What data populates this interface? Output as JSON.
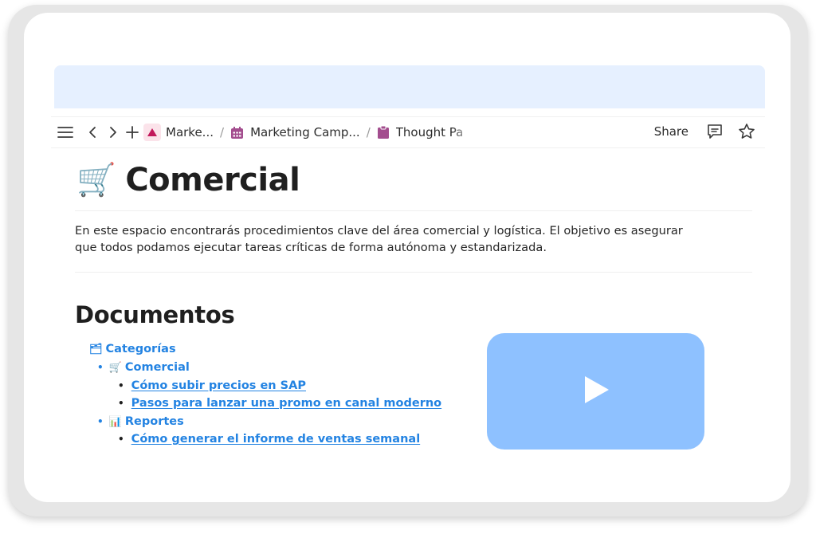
{
  "toolbar": {
    "breadcrumbs": [
      {
        "label": "Marke...",
        "icon": "triangle-page-icon",
        "icon_color": "#c2185b"
      },
      {
        "label": "Marketing Camp...",
        "icon": "calendar-icon",
        "icon_color": "#a34d8e"
      },
      {
        "label": "Thought Pa",
        "icon": "clipboard-icon",
        "icon_color": "#a34d8e"
      }
    ],
    "separator": "/",
    "share_label": "Share"
  },
  "page": {
    "title_emoji": "🛒",
    "title": "Comercial",
    "intro_line1": "En este espacio encontrarás procedimientos clave del área comercial y logística. El objetivo es asegurar",
    "intro_line2": "que todos podamos ejecutar tareas críticas de forma autónoma y estandarizada."
  },
  "documents": {
    "heading": "Documentos",
    "root": {
      "emoji": "🗂",
      "label": "Categorías"
    },
    "groups": [
      {
        "emoji": "🛒",
        "label": "Comercial",
        "items": [
          "Cómo subir precios en SAP",
          "Pasos para lanzar una promo en canal moderno"
        ]
      },
      {
        "emoji": "📊",
        "label": "Reportes",
        "items": [
          "Cómo generar el informe de ventas semanal"
        ]
      }
    ]
  },
  "colors": {
    "accent": "#2383e2",
    "banner": "#e6f0ff",
    "video": "#8ec1ff"
  }
}
